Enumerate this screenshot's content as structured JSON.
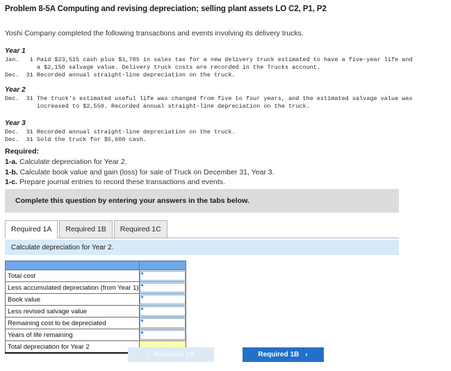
{
  "problem": {
    "title": "Problem 8-5A Computing and revising depreciation; selling plant assets LO C2, P1, P2",
    "intro": "Yoshi Company completed the following transactions and events involving its delivery trucks."
  },
  "years": [
    {
      "label": "Year 1",
      "lines": [
        "Jan.   1 Paid $23,515 cash plus $1,785 in sales tax for a new delivery truck estimated to have a five-year life and",
        "         a $2,150 salvage value. Delivery truck costs are recorded in the Trucks account.",
        "Dec.  31 Recorded annual straight-line depreciation on the truck."
      ]
    },
    {
      "label": "Year 2",
      "lines": [
        "Dec.  31 The truck's estimated useful life was changed from five to four years, and the estimated salvage value was",
        "         increased to $2,550. Recorded annual straight-line depreciation on the truck."
      ]
    },
    {
      "label": "Year 3",
      "lines": [
        "Dec.  31 Recorded annual straight-line depreciation on the truck.",
        "Dec.  31 Sold the truck for $5,600 cash."
      ]
    }
  ],
  "required": {
    "heading": "Required:",
    "items": [
      {
        "marker": "1-a.",
        "text": "Calculate depreciation for Year 2."
      },
      {
        "marker": "1-b.",
        "text": "Calculate book value and gain (loss) for sale of Truck on December 31, Year 3."
      },
      {
        "marker": "1-c.",
        "text": "Prepare journal entries to record these transactions and events."
      }
    ]
  },
  "banner": {
    "text": "Complete this question by entering your answers in the tabs below."
  },
  "tabs": [
    {
      "label": "Required 1A",
      "active": true
    },
    {
      "label": "Required 1B",
      "active": false
    },
    {
      "label": "Required 1C",
      "active": false
    }
  ],
  "sub_instruction": {
    "text": "Calculate depreciation for Year 2."
  },
  "answer_table": {
    "rows": [
      {
        "label": "Total cost",
        "value": "",
        "type": "input"
      },
      {
        "label": "Less accumulated depreciation (from Year 1)",
        "value": "",
        "type": "input"
      },
      {
        "label": "Book value",
        "value": "",
        "type": "input"
      },
      {
        "label": "Less revised salvage value",
        "value": "",
        "type": "input"
      },
      {
        "label": "Remaining cost to be depreciated",
        "value": "",
        "type": "input"
      },
      {
        "label": "Years of life remaining",
        "value": "",
        "type": "input"
      },
      {
        "label": "Total depreciation for Year 2",
        "value": "",
        "type": "total"
      }
    ]
  },
  "navigation": {
    "prev_label": "Required 1A",
    "next_label": "Required 1B",
    "prev_chevron": "‹",
    "next_chevron": "›"
  },
  "colors": {
    "banner_gray": "#dcdcdc",
    "sub_instruction_blue": "#d6eaf8",
    "table_header_blue": "#6fa8e8",
    "total_yellow": "#fcfcae",
    "primary_button_blue": "#2270c9",
    "disabled_button_blue": "#dfe9f5"
  }
}
